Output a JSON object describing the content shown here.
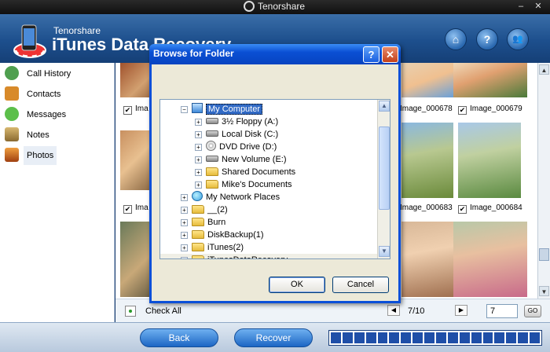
{
  "titlebar": {
    "brand": "Tenorshare",
    "minimize": "–",
    "close": "✕"
  },
  "header": {
    "subtitle": "Tenorshare",
    "title": "iTunes Data Recovery",
    "buttons": [
      {
        "name": "home-button",
        "icon": "home-icon",
        "glyph": "⌂"
      },
      {
        "name": "help-button",
        "icon": "help-icon",
        "glyph": "?"
      },
      {
        "name": "account-button",
        "icon": "users-icon",
        "glyph": "👥"
      }
    ]
  },
  "sidebar": {
    "items": [
      {
        "label": "Call History",
        "icon": "call-history-icon",
        "color": "#4f9f4f",
        "active": false
      },
      {
        "label": "Contacts",
        "icon": "contacts-icon",
        "color": "#d88a2a",
        "active": false
      },
      {
        "label": "Messages",
        "icon": "messages-icon",
        "color": "#5cbf4a",
        "active": false
      },
      {
        "label": "Notes",
        "icon": "notes-icon",
        "color": "#e0c060",
        "active": false
      },
      {
        "label": "Photos",
        "icon": "photos-icon",
        "color": "#c86a20",
        "active": true
      }
    ]
  },
  "photos": {
    "captions": [
      {
        "text": "Ima",
        "checked": true
      },
      {
        "text": "Image_000678",
        "checked": false
      },
      {
        "text": "Image_000679",
        "checked": true
      },
      {
        "text": "Ima",
        "checked": true
      },
      {
        "text": "Image_000683",
        "checked": false
      },
      {
        "text": "Image_000684",
        "checked": true
      }
    ]
  },
  "pager": {
    "check_all": "Check All",
    "prev": "◀",
    "next": "▶",
    "page_text": "7/10",
    "page_input": "7",
    "go": "GO"
  },
  "footer": {
    "back": "Back",
    "recover": "Recover",
    "progress_segments": 18
  },
  "dialog": {
    "title": "Browse for Folder",
    "help": "?",
    "close": "✕",
    "tree": [
      {
        "label": "My Computer",
        "icon": "computer-icon",
        "type": "computer",
        "expander": "−",
        "indent": 0,
        "selected": true
      },
      {
        "label": "3½ Floppy (A:)",
        "icon": "floppy-drive-icon",
        "type": "drive",
        "expander": "+",
        "indent": 1,
        "selected": false
      },
      {
        "label": "Local Disk (C:)",
        "icon": "hard-drive-icon",
        "type": "drive",
        "expander": "+",
        "indent": 1,
        "selected": false
      },
      {
        "label": "DVD Drive (D:)",
        "icon": "dvd-drive-icon",
        "type": "disc",
        "expander": "+",
        "indent": 1,
        "selected": false
      },
      {
        "label": "New Volume (E:)",
        "icon": "hard-drive-icon",
        "type": "drive",
        "expander": "+",
        "indent": 1,
        "selected": false
      },
      {
        "label": "Shared Documents",
        "icon": "folder-icon",
        "type": "folder",
        "expander": "+",
        "indent": 1,
        "selected": false
      },
      {
        "label": "Mike's Documents",
        "icon": "folder-icon",
        "type": "folder",
        "expander": "+",
        "indent": 1,
        "selected": false
      },
      {
        "label": "My Network Places",
        "icon": "network-icon",
        "type": "network",
        "expander": "+",
        "indent": 0,
        "selected": false
      },
      {
        "label": "__(2)",
        "icon": "folder-icon",
        "type": "folder",
        "expander": "+",
        "indent": 0,
        "selected": false
      },
      {
        "label": "Burn",
        "icon": "folder-icon",
        "type": "folder",
        "expander": "+",
        "indent": 0,
        "selected": false
      },
      {
        "label": "DiskBackup(1)",
        "icon": "folder-icon",
        "type": "folder",
        "expander": "+",
        "indent": 0,
        "selected": false
      },
      {
        "label": "iTunes(2)",
        "icon": "folder-icon",
        "type": "folder",
        "expander": "+",
        "indent": 0,
        "selected": false
      },
      {
        "label": "iTunesDataRecovery",
        "icon": "folder-icon",
        "type": "folder",
        "expander": "+",
        "indent": 0,
        "selected": false
      }
    ],
    "ok": "OK",
    "cancel": "Cancel"
  }
}
